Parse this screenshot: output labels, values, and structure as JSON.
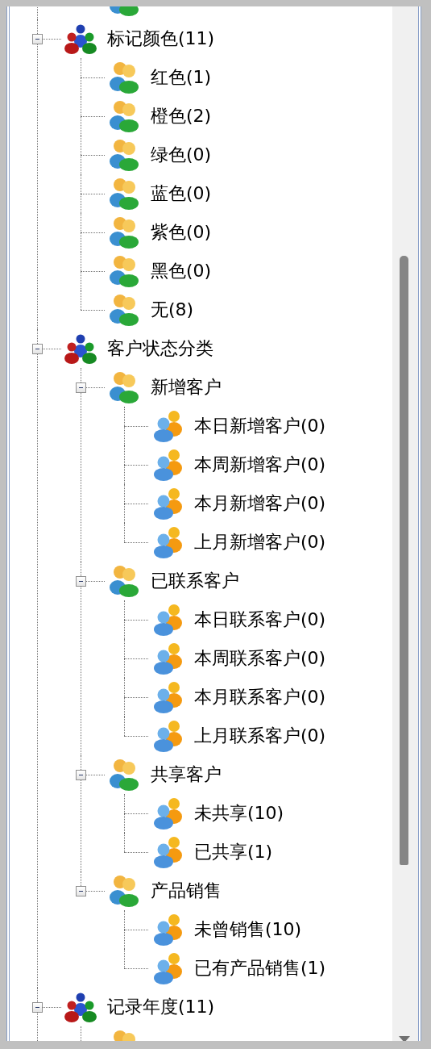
{
  "tree": [
    {
      "label": "标记颜色(11)",
      "kind": "category",
      "expanded": true,
      "children": [
        {
          "label": "红色(1)",
          "kind": "group"
        },
        {
          "label": "橙色(2)",
          "kind": "group"
        },
        {
          "label": "绿色(0)",
          "kind": "group"
        },
        {
          "label": "蓝色(0)",
          "kind": "group"
        },
        {
          "label": "紫色(0)",
          "kind": "group"
        },
        {
          "label": "黑色(0)",
          "kind": "group"
        },
        {
          "label": "无(8)",
          "kind": "group"
        }
      ]
    },
    {
      "label": "客户状态分类",
      "kind": "category",
      "expanded": true,
      "children": [
        {
          "label": "新增客户",
          "kind": "group",
          "expanded": true,
          "children": [
            {
              "label": "本日新增客户(0)",
              "kind": "contact"
            },
            {
              "label": "本周新增客户(0)",
              "kind": "contact"
            },
            {
              "label": "本月新增客户(0)",
              "kind": "contact"
            },
            {
              "label": "上月新增客户(0)",
              "kind": "contact"
            }
          ]
        },
        {
          "label": "已联系客户",
          "kind": "group",
          "expanded": true,
          "children": [
            {
              "label": "本日联系客户(0)",
              "kind": "contact"
            },
            {
              "label": "本周联系客户(0)",
              "kind": "contact"
            },
            {
              "label": "本月联系客户(0)",
              "kind": "contact"
            },
            {
              "label": "上月联系客户(0)",
              "kind": "contact"
            }
          ]
        },
        {
          "label": "共享客户",
          "kind": "group",
          "expanded": true,
          "children": [
            {
              "label": "未共享(10)",
              "kind": "contact"
            },
            {
              "label": "已共享(1)",
              "kind": "contact"
            }
          ]
        },
        {
          "label": "产品销售",
          "kind": "group",
          "expanded": true,
          "children": [
            {
              "label": "未曾销售(10)",
              "kind": "contact"
            },
            {
              "label": "已有产品销售(1)",
              "kind": "contact"
            }
          ]
        }
      ]
    },
    {
      "label": "记录年度(11)",
      "kind": "category",
      "expanded": true
    }
  ]
}
